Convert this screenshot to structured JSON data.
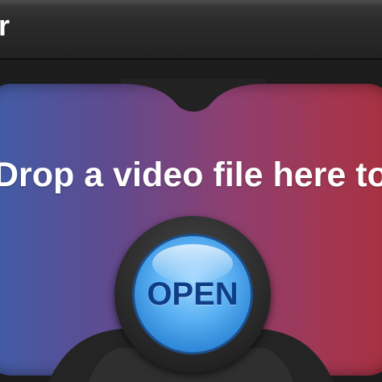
{
  "window": {
    "title": "r"
  },
  "dropzone": {
    "text": "Drop a video file here to convert"
  },
  "open_button": {
    "label": "OPEN"
  },
  "colors": {
    "gradient_left": "#3f5ea8",
    "gradient_right": "#a8303f",
    "button_blue": "#5cb2f3",
    "button_text": "#0f3d86"
  }
}
